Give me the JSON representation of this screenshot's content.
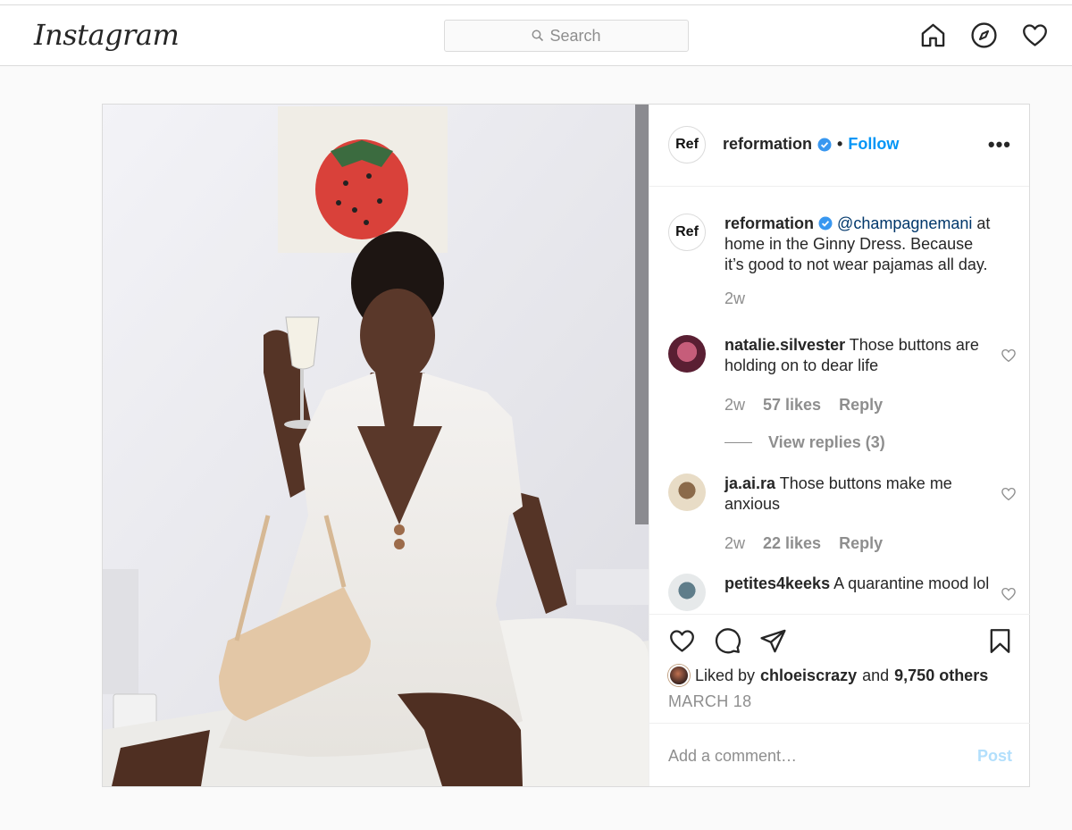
{
  "header": {
    "logo": "Instagram",
    "search_placeholder": "Search",
    "nav_icons": [
      "home-icon",
      "explore-compass-icon",
      "activity-heart-icon"
    ]
  },
  "post": {
    "avatar_text": "Ref",
    "username": "reformation",
    "separator": "•",
    "follow_label": "Follow",
    "more_label": "•••",
    "caption": {
      "avatar_text": "Ref",
      "username": "reformation",
      "mention": "@champagnemani",
      "text": " at home in the Ginny Dress. Because it’s good to not wear pajamas all day.",
      "time": "2w"
    },
    "comments": [
      {
        "username": "natalie.silvester",
        "text": " Those buttons are holding on to dear life",
        "time": "2w",
        "likes": "57 likes",
        "reply_label": "Reply",
        "view_replies": "View replies (3)"
      },
      {
        "username": "ja.ai.ra",
        "text": " Those buttons make me anxious",
        "time": "2w",
        "likes": "22 likes",
        "reply_label": "Reply"
      },
      {
        "username": "petites4keeks",
        "text": " A quarantine mood lol"
      }
    ],
    "liked_prefix": "Liked by ",
    "liked_user": "chloeiscrazy",
    "liked_and": " and ",
    "liked_others": "9,750 others",
    "date": "MARCH 18",
    "add_comment_placeholder": "Add a comment…",
    "post_label": "Post"
  },
  "colors": {
    "link_blue": "#0095f6",
    "muted": "#8e8e8e",
    "border": "#dbdbdb",
    "post_disabled": "#b2dffc"
  }
}
